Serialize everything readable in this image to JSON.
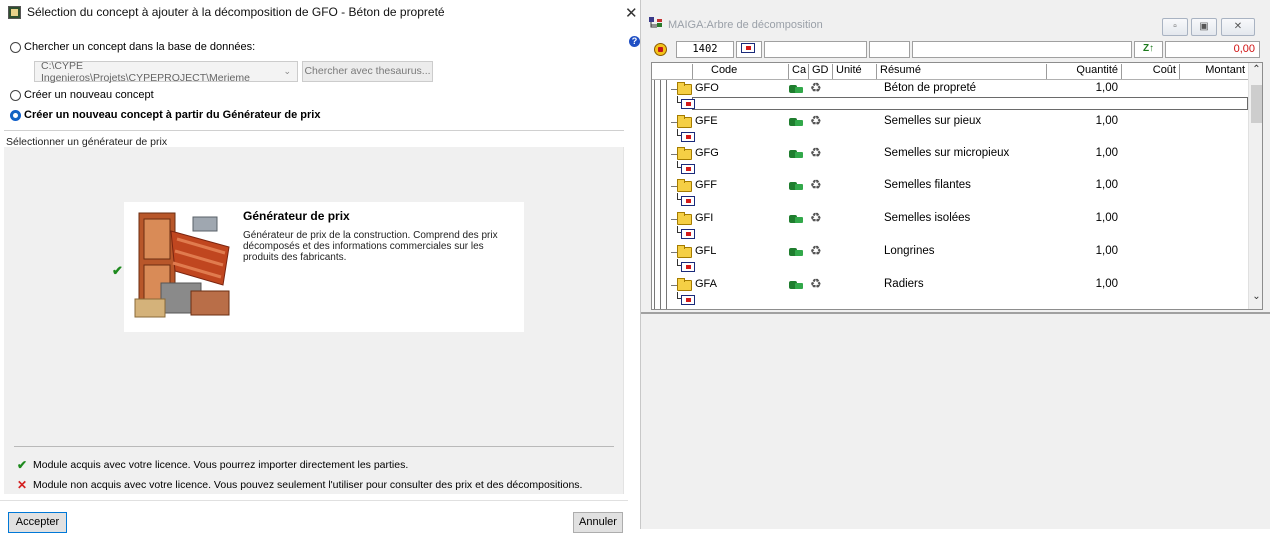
{
  "dialog": {
    "title": "Sélection du concept à ajouter à la décomposition de GFO - Béton de propreté",
    "close_glyph": "✕",
    "option_search_label": "Chercher un concept dans la base de données:",
    "path_value": "C:\\CYPE Ingenieros\\Projets\\CYPEPROJECT\\Merieme",
    "thesaurus_button": "Chercher avec thesaurus...",
    "option_new_label": "Créer un nouveau concept",
    "option_generator_label": "Créer un nouveau concept à partir du Générateur de prix",
    "selected_option": "generator",
    "panel_label": "Sélectionner un générateur de prix",
    "generator": {
      "title": "Générateur de prix",
      "description": "Générateur de prix de la construction. Comprend des prix décomposés et des informations commerciales sur les produits des fabricants.",
      "status": "acquired"
    },
    "legend_acquired": "Module acquis avec votre licence. Vous pourrez importer directement les parties.",
    "legend_not_acquired": "Module non acquis avec votre licence. Vous pouvez seulement l'utiliser pour consulter des prix et des décompositions.",
    "accept_button": "Accepter",
    "cancel_button": "Annuler"
  },
  "mdi": {
    "title": "MAIGA:Arbre de décomposition",
    "toolbar": {
      "code_value": "1402",
      "total_value": "0,00",
      "total_color": "#d01010"
    },
    "columns": [
      "Code",
      "Ca",
      "GD",
      "Unité",
      "Résumé",
      "Quantité",
      "Coût",
      "Montant"
    ],
    "rows": [
      {
        "code": "GFO",
        "resume": "Béton de propreté",
        "qty": "1,00"
      },
      {
        "code": "GFE",
        "resume": "Semelles sur pieux",
        "qty": "1,00"
      },
      {
        "code": "GFG",
        "resume": "Semelles sur micropieux",
        "qty": "1,00"
      },
      {
        "code": "GFF",
        "resume": "Semelles filantes",
        "qty": "1,00"
      },
      {
        "code": "GFI",
        "resume": "Semelles isolées",
        "qty": "1,00"
      },
      {
        "code": "GFL",
        "resume": "Longrines",
        "qty": "1,00"
      },
      {
        "code": "GFA",
        "resume": "Radiers",
        "qty": "1,00"
      }
    ]
  }
}
